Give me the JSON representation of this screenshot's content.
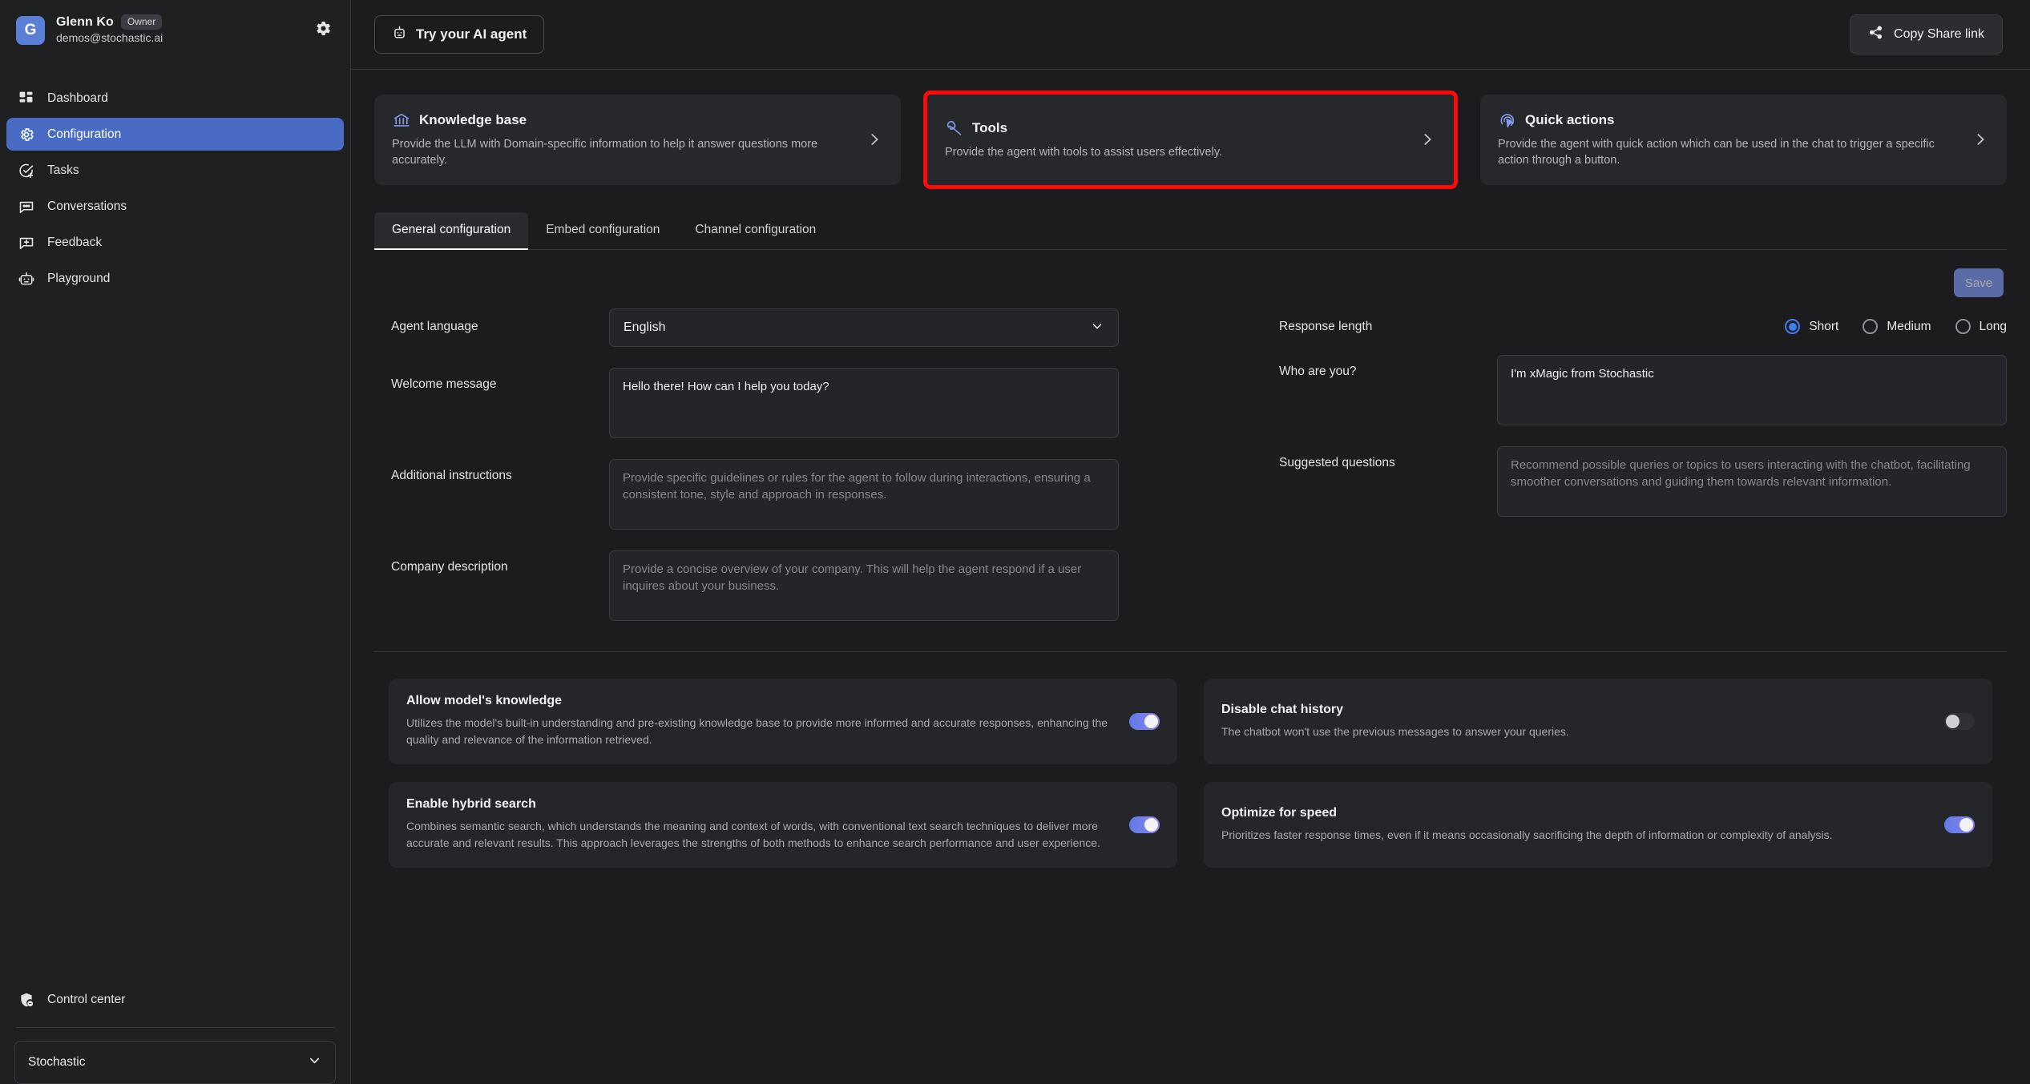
{
  "sidebar": {
    "avatar_initial": "G",
    "user_name": "Glenn Ko",
    "role_badge": "Owner",
    "email": "demos@stochastic.ai",
    "nav": [
      {
        "label": "Dashboard",
        "icon": "dashboard-icon",
        "active": false
      },
      {
        "label": "Configuration",
        "icon": "gear-icon",
        "active": true
      },
      {
        "label": "Tasks",
        "icon": "task-check-icon",
        "active": false
      },
      {
        "label": "Conversations",
        "icon": "chat-bubble-icon",
        "active": false
      },
      {
        "label": "Feedback",
        "icon": "feedback-icon",
        "active": false
      },
      {
        "label": "Playground",
        "icon": "robot-icon",
        "active": false
      }
    ],
    "control_center": "Control center",
    "org_name": "Stochastic"
  },
  "topbar": {
    "try_agent_label": "Try your AI agent",
    "copy_share_label": "Copy Share link"
  },
  "cards": [
    {
      "title": "Knowledge base",
      "desc": "Provide the LLM with Domain-specific information to help it answer questions more accurately.",
      "icon": "bank-icon",
      "highlighted": false
    },
    {
      "title": "Tools",
      "desc": "Provide the agent with tools to assist users effectively.",
      "icon": "wrench-icon",
      "highlighted": true
    },
    {
      "title": "Quick actions",
      "desc": "Provide the agent with quick action which can be used in the chat to trigger a specific action through a button.",
      "icon": "cursor-click-icon",
      "highlighted": false
    }
  ],
  "tabs": [
    {
      "label": "General configuration",
      "active": true
    },
    {
      "label": "Embed configuration",
      "active": false
    },
    {
      "label": "Channel configuration",
      "active": false
    }
  ],
  "save_label": "Save",
  "form": {
    "agent_language": {
      "label": "Agent language",
      "value": "English"
    },
    "response_length": {
      "label": "Response length",
      "options": [
        "Short",
        "Medium",
        "Long"
      ],
      "selected": "Short"
    },
    "welcome_message": {
      "label": "Welcome message",
      "value": "Hello there! How can I help you today?",
      "placeholder": ""
    },
    "who_are_you": {
      "label": "Who are you?",
      "value": "I'm xMagic from Stochastic",
      "placeholder": ""
    },
    "additional_instructions": {
      "label": "Additional instructions",
      "value": "",
      "placeholder": "Provide specific guidelines or rules for the agent to follow during interactions, ensuring a consistent tone, style and approach in responses."
    },
    "suggested_questions": {
      "label": "Suggested questions",
      "value": "",
      "placeholder": "Recommend possible queries or topics to users interacting with the chatbot, facilitating smoother conversations and guiding them towards relevant information."
    },
    "company_description": {
      "label": "Company description",
      "value": "",
      "placeholder": "Provide a concise overview of your company. This will help the agent respond if a user inquires about your business."
    }
  },
  "toggles": [
    {
      "title": "Allow model's knowledge",
      "desc": "Utilizes the model's built-in understanding and pre-existing knowledge base to provide more informed and accurate responses, enhancing the quality and relevance of the information retrieved.",
      "on": true
    },
    {
      "title": "Disable chat history",
      "desc": "The chatbot won't use the previous messages to answer your queries.",
      "on": false
    },
    {
      "title": "Enable hybrid search",
      "desc": "Combines semantic search, which understands the meaning and context of words, with conventional text search techniques to deliver more accurate and relevant results. This approach leverages the strengths of both methods to enhance search performance and user experience.",
      "on": true
    },
    {
      "title": "Optimize for speed",
      "desc": "Prioritizes faster response times, even if it means occasionally sacrificing the depth of information or complexity of analysis.",
      "on": true
    }
  ],
  "colors": {
    "accent_blue": "#4a6bc4",
    "highlight_red": "#fb0a0a",
    "toggle_on_start": "#5f7ce8",
    "toggle_on_end": "#8f7ff0",
    "radio_selected": "#3f7ef0",
    "card_bg": "#27282b",
    "page_bg": "#1c1c1e"
  }
}
